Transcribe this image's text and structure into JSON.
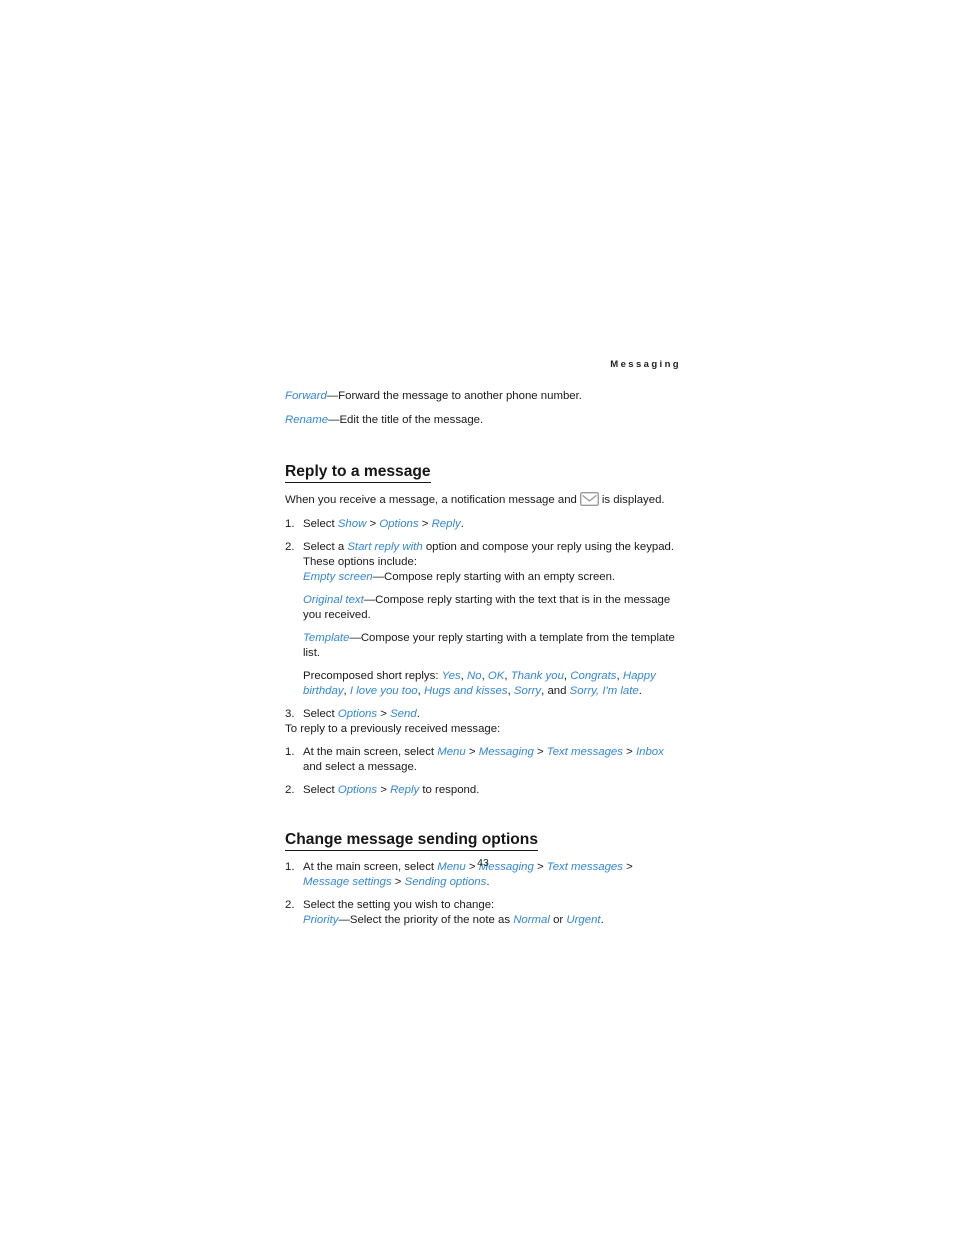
{
  "header": {
    "running_head": "Messaging"
  },
  "intro": {
    "forward_term": "Forward",
    "forward_text": "—Forward the message to another phone number.",
    "rename_term": "Rename",
    "rename_text": "—Edit the title of the message."
  },
  "section_reply": {
    "heading": "Reply to a message",
    "lead_before": "When you receive a message, a notification message and",
    "lead_icon": "envelope-icon",
    "lead_after": "is displayed.",
    "steps": [
      {
        "number": "1.",
        "prefix": "Select ",
        "terms": [
          "Show",
          "Options",
          "Reply"
        ],
        "suffix": "."
      },
      {
        "number": "2.",
        "prefix": "Select a ",
        "term": "Start reply with",
        "suffix": " option and compose your reply using the keypad. These options include:"
      }
    ],
    "options": [
      {
        "term": "Empty screen",
        "text": "—Compose reply starting with an empty screen."
      },
      {
        "term": "Original text",
        "text": "—Compose reply starting with the text that is in the message you received."
      },
      {
        "term": "Template",
        "text": "—Compose your reply starting with a template from the template list."
      }
    ],
    "precomposed_label": "Precomposed short replys: ",
    "precomposed_replies": [
      "Yes",
      "No",
      "OK",
      "Thank you",
      "Congrats",
      "Happy birthday",
      "I love you too",
      "Hugs and kisses",
      "Sorry",
      "Sorry, I'm late"
    ],
    "precomposed_and": "and",
    "step3": {
      "number": "3.",
      "prefix": "Select ",
      "terms": [
        "Options",
        "Send"
      ],
      "suffix": "."
    },
    "previously_lead": "To reply to a previously received message:",
    "prev_steps": [
      {
        "number": "1.",
        "prefix": "At the main screen, select ",
        "terms": [
          "Menu",
          "Messaging",
          "Text messages",
          "Inbox"
        ],
        "suffix": " and select a message."
      },
      {
        "number": "2.",
        "prefix": "Select ",
        "terms": [
          "Options",
          "Reply"
        ],
        "suffix": " to respond."
      }
    ]
  },
  "section_sending": {
    "heading": "Change message sending options",
    "steps": [
      {
        "number": "1.",
        "prefix": "At the main screen, select ",
        "terms": [
          "Menu",
          "Messaging",
          "Text messages",
          "Message settings",
          "Sending options"
        ],
        "suffix": "."
      },
      {
        "number": "2.",
        "text": "Select the setting you wish to change:"
      }
    ],
    "priority": {
      "term": "Priority",
      "text_before": "—Select the priority of the note as ",
      "option_normal": "Normal",
      "conjunction": " or ",
      "option_urgent": "Urgent",
      "text_after": "."
    }
  },
  "footer": {
    "page_number": "43"
  },
  "colors": {
    "term_blue": "#3387d6",
    "body_text": "#1a1a1a",
    "heading": "#161616",
    "icon_gray": "#9a9a9a"
  }
}
